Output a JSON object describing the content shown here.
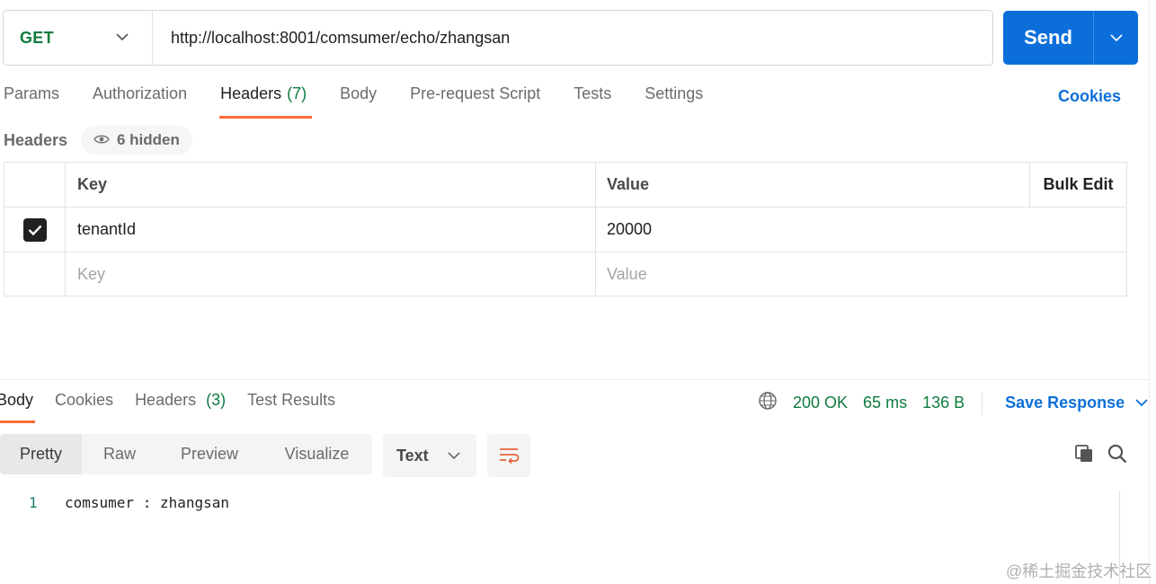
{
  "request": {
    "method": "GET",
    "url": "http://localhost:8001/comsumer/echo/zhangsan",
    "send_label": "Send"
  },
  "request_tabs": {
    "params": "Params",
    "authorization": "Authorization",
    "headers": "Headers",
    "headers_count": "(7)",
    "body": "Body",
    "prerequest": "Pre-request Script",
    "tests": "Tests",
    "settings": "Settings",
    "cookies": "Cookies"
  },
  "headers_section": {
    "title": "Headers",
    "hidden_label": "6 hidden",
    "columns": {
      "key": "Key",
      "value": "Value",
      "bulk_edit": "Bulk Edit"
    },
    "rows": [
      {
        "checked": true,
        "key": "tenantId",
        "value": "20000"
      }
    ],
    "placeholder": {
      "key": "Key",
      "value": "Value"
    }
  },
  "response": {
    "tabs": {
      "body": "Body",
      "cookies": "Cookies",
      "headers": "Headers",
      "headers_count": "(3)",
      "test_results": "Test Results"
    },
    "status": "200 OK",
    "time": "65 ms",
    "size": "136 B",
    "save_label": "Save Response",
    "format_tabs": [
      "Pretty",
      "Raw",
      "Preview",
      "Visualize"
    ],
    "language": "Text",
    "code_lines": [
      {
        "number": "1",
        "text": "comsumer : zhangsan"
      }
    ]
  },
  "watermark": "@稀土掘金技术社区",
  "colors": {
    "accent_blue": "#0c6fd9",
    "method_green": "#0f7b3f",
    "tab_underline": "#ff6c37"
  }
}
